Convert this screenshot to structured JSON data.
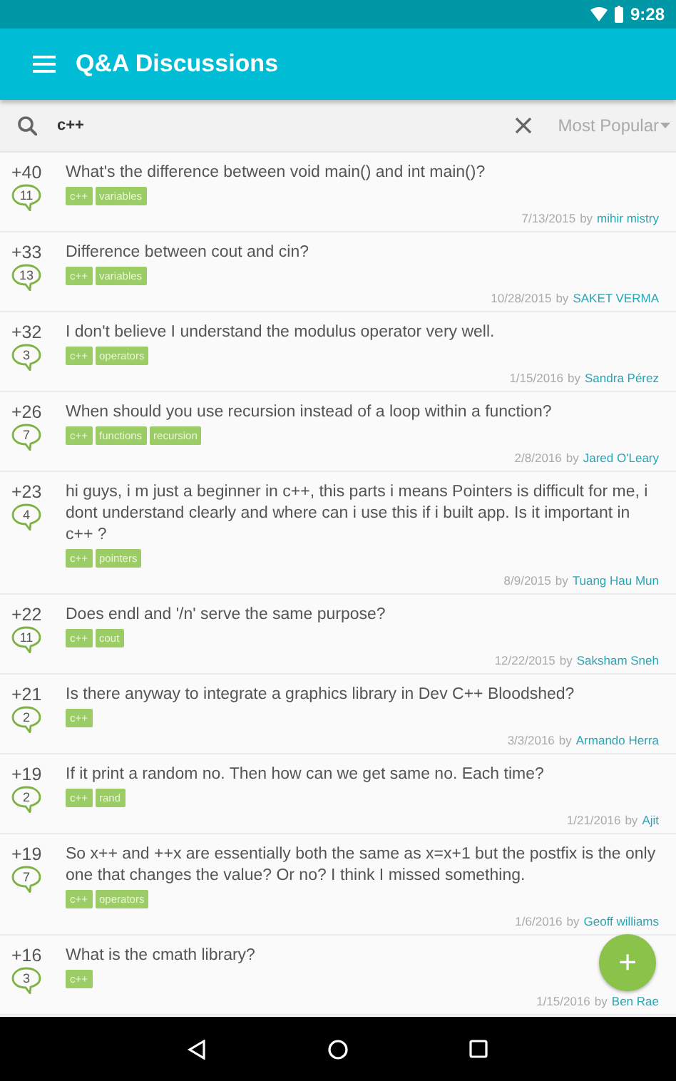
{
  "status_bar": {
    "time": "9:28"
  },
  "toolbar": {
    "title": "Q&A Discussions"
  },
  "search": {
    "value": "c++",
    "sort": "Most Popular"
  },
  "questions": [
    {
      "score": "+40",
      "answers": "11",
      "title": "What's the difference between void main() and int main()?",
      "tags": [
        "c++",
        "variables"
      ],
      "date": "7/13/2015",
      "by": "by",
      "author": "mihir mistry"
    },
    {
      "score": "+33",
      "answers": "13",
      "title": "Difference between cout and cin?",
      "tags": [
        "c++",
        "variables"
      ],
      "date": "10/28/2015",
      "by": "by",
      "author": "SAKET VERMA"
    },
    {
      "score": "+32",
      "answers": "3",
      "title": "I don't believe I understand the modulus operator very well.",
      "tags": [
        "c++",
        "operators"
      ],
      "date": "1/15/2016",
      "by": "by",
      "author": "Sandra Pérez"
    },
    {
      "score": "+26",
      "answers": "7",
      "title": "When should you use recursion instead of a loop within a function?",
      "tags": [
        "c++",
        "functions",
        "recursion"
      ],
      "date": "2/8/2016",
      "by": "by",
      "author": "Jared O'Leary"
    },
    {
      "score": "+23",
      "answers": "4",
      "title": "hi guys, i m just a beginner in c++, this parts i means Pointers is difficult for me, i dont understand clearly and where can i use this if i built app. Is it important in c++ ?",
      "tags": [
        "c++",
        "pointers"
      ],
      "date": "8/9/2015",
      "by": "by",
      "author": "Tuang Hau Mun"
    },
    {
      "score": "+22",
      "answers": "11",
      "title": "Does endl and '/n' serve the same purpose?",
      "tags": [
        "c++",
        "cout"
      ],
      "date": "12/22/2015",
      "by": "by",
      "author": "Saksham Sneh"
    },
    {
      "score": "+21",
      "answers": "2",
      "title": "Is there anyway to integrate a graphics library in Dev C++ Bloodshed?",
      "tags": [
        "c++"
      ],
      "date": "3/3/2016",
      "by": "by",
      "author": "Armando Herra"
    },
    {
      "score": "+19",
      "answers": "2",
      "title": "If it print a random no. Then how can we get same no. Each time?",
      "tags": [
        "c++",
        "rand"
      ],
      "date": "1/21/2016",
      "by": "by",
      "author": "Ajit"
    },
    {
      "score": "+19",
      "answers": "7",
      "title": "So x++ and ++x are essentially both the same as x=x+1 but the postfix is the only one that changes the value? Or no? I think I missed something.",
      "tags": [
        "c++",
        "operators"
      ],
      "date": "1/6/2016",
      "by": "by",
      "author": "Geoff williams"
    },
    {
      "score": "+16",
      "answers": "3",
      "title": "What is the cmath library?",
      "tags": [
        "c++"
      ],
      "date": "1/15/2016",
      "by": "by",
      "author": "Ben Rae"
    }
  ],
  "fab": {
    "symbol": "+"
  }
}
